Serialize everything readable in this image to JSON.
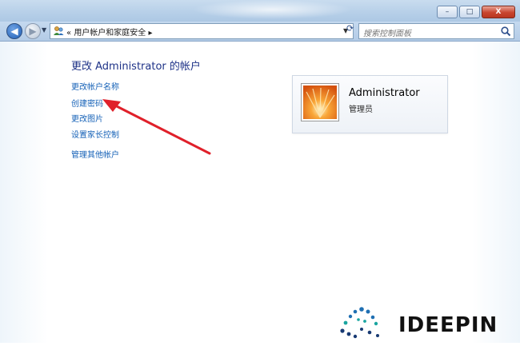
{
  "window": {
    "minimize_label": "–",
    "maximize_label": "□",
    "close_label": "X"
  },
  "nav": {
    "back_symbol": "◀",
    "forward_symbol": "▶",
    "history_symbol": "▼",
    "address_separator": "«",
    "address_text": "用户帐户和家庭安全",
    "address_chevron": "▸",
    "address_dropdown": "▼",
    "refresh_symbol": "⟳",
    "search_placeholder": "搜索控制面板"
  },
  "page": {
    "title": "更改 Administrator 的帐户",
    "tasks": [
      {
        "label": "更改帐户名称"
      },
      {
        "label": "创建密码"
      },
      {
        "label": "更改图片"
      },
      {
        "label": "设置家长控制"
      },
      {
        "label": "管理其他帐户"
      }
    ]
  },
  "account": {
    "name": "Administrator",
    "role": "管理员"
  },
  "watermark": {
    "text": "IDEEPIN"
  },
  "colors": {
    "link": "#1561b7",
    "title": "#1e3287",
    "arrow": "#e0202a"
  }
}
